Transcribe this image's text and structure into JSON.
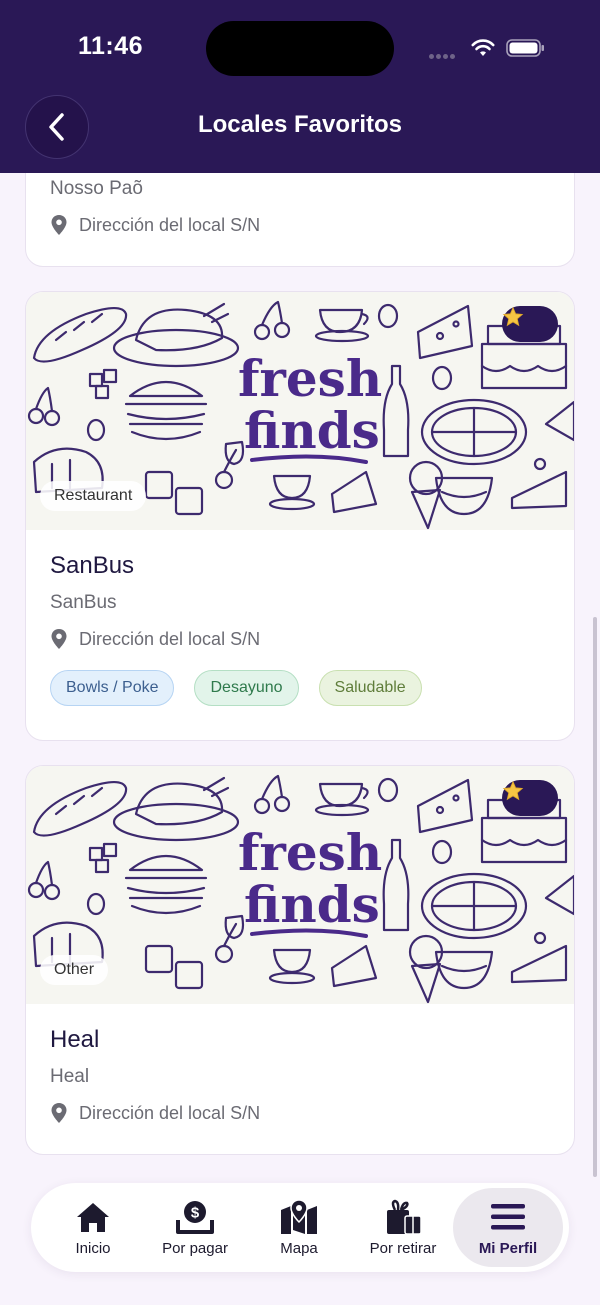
{
  "status_bar": {
    "time": "11:46"
  },
  "header": {
    "title": "Locales Favoritos"
  },
  "banner_text": {
    "line1": "fresh",
    "line2": "finds"
  },
  "partial_card": {
    "subtitle": "Nosso Paõ",
    "address": "Dirección del local S/N"
  },
  "cards": [
    {
      "category": "Restaurant",
      "name": "SanBus",
      "subtitle": "SanBus",
      "address": "Dirección del local S/N",
      "favorite": true,
      "tags": [
        {
          "label": "Bowls / Poke",
          "bg": "#e3f0fc",
          "border": "#b6d4f3",
          "color": "#3c5f8f"
        },
        {
          "label": "Desayuno",
          "bg": "#e2f4ea",
          "border": "#b4dfc4",
          "color": "#2f7a4c"
        },
        {
          "label": "Saludable",
          "bg": "#eaf3df",
          "border": "#c9e0b0",
          "color": "#5f7d3a"
        }
      ]
    },
    {
      "category": "Other",
      "name": "Heal",
      "subtitle": "Heal",
      "address": "Dirección del local S/N",
      "favorite": true,
      "tags": []
    }
  ],
  "tabbar": {
    "items": [
      {
        "label": "Inicio",
        "icon": "home-icon"
      },
      {
        "label": "Por pagar",
        "icon": "dollar-tray-icon"
      },
      {
        "label": "Mapa",
        "icon": "map-pin-icon"
      },
      {
        "label": "Por retirar",
        "icon": "gift-icon"
      },
      {
        "label": "Mi Perfil",
        "icon": "menu-icon",
        "active": true
      }
    ]
  },
  "colors": {
    "header": "#2a1856",
    "brand_text": "#4a2a8a",
    "background": "#f8f3fc"
  }
}
